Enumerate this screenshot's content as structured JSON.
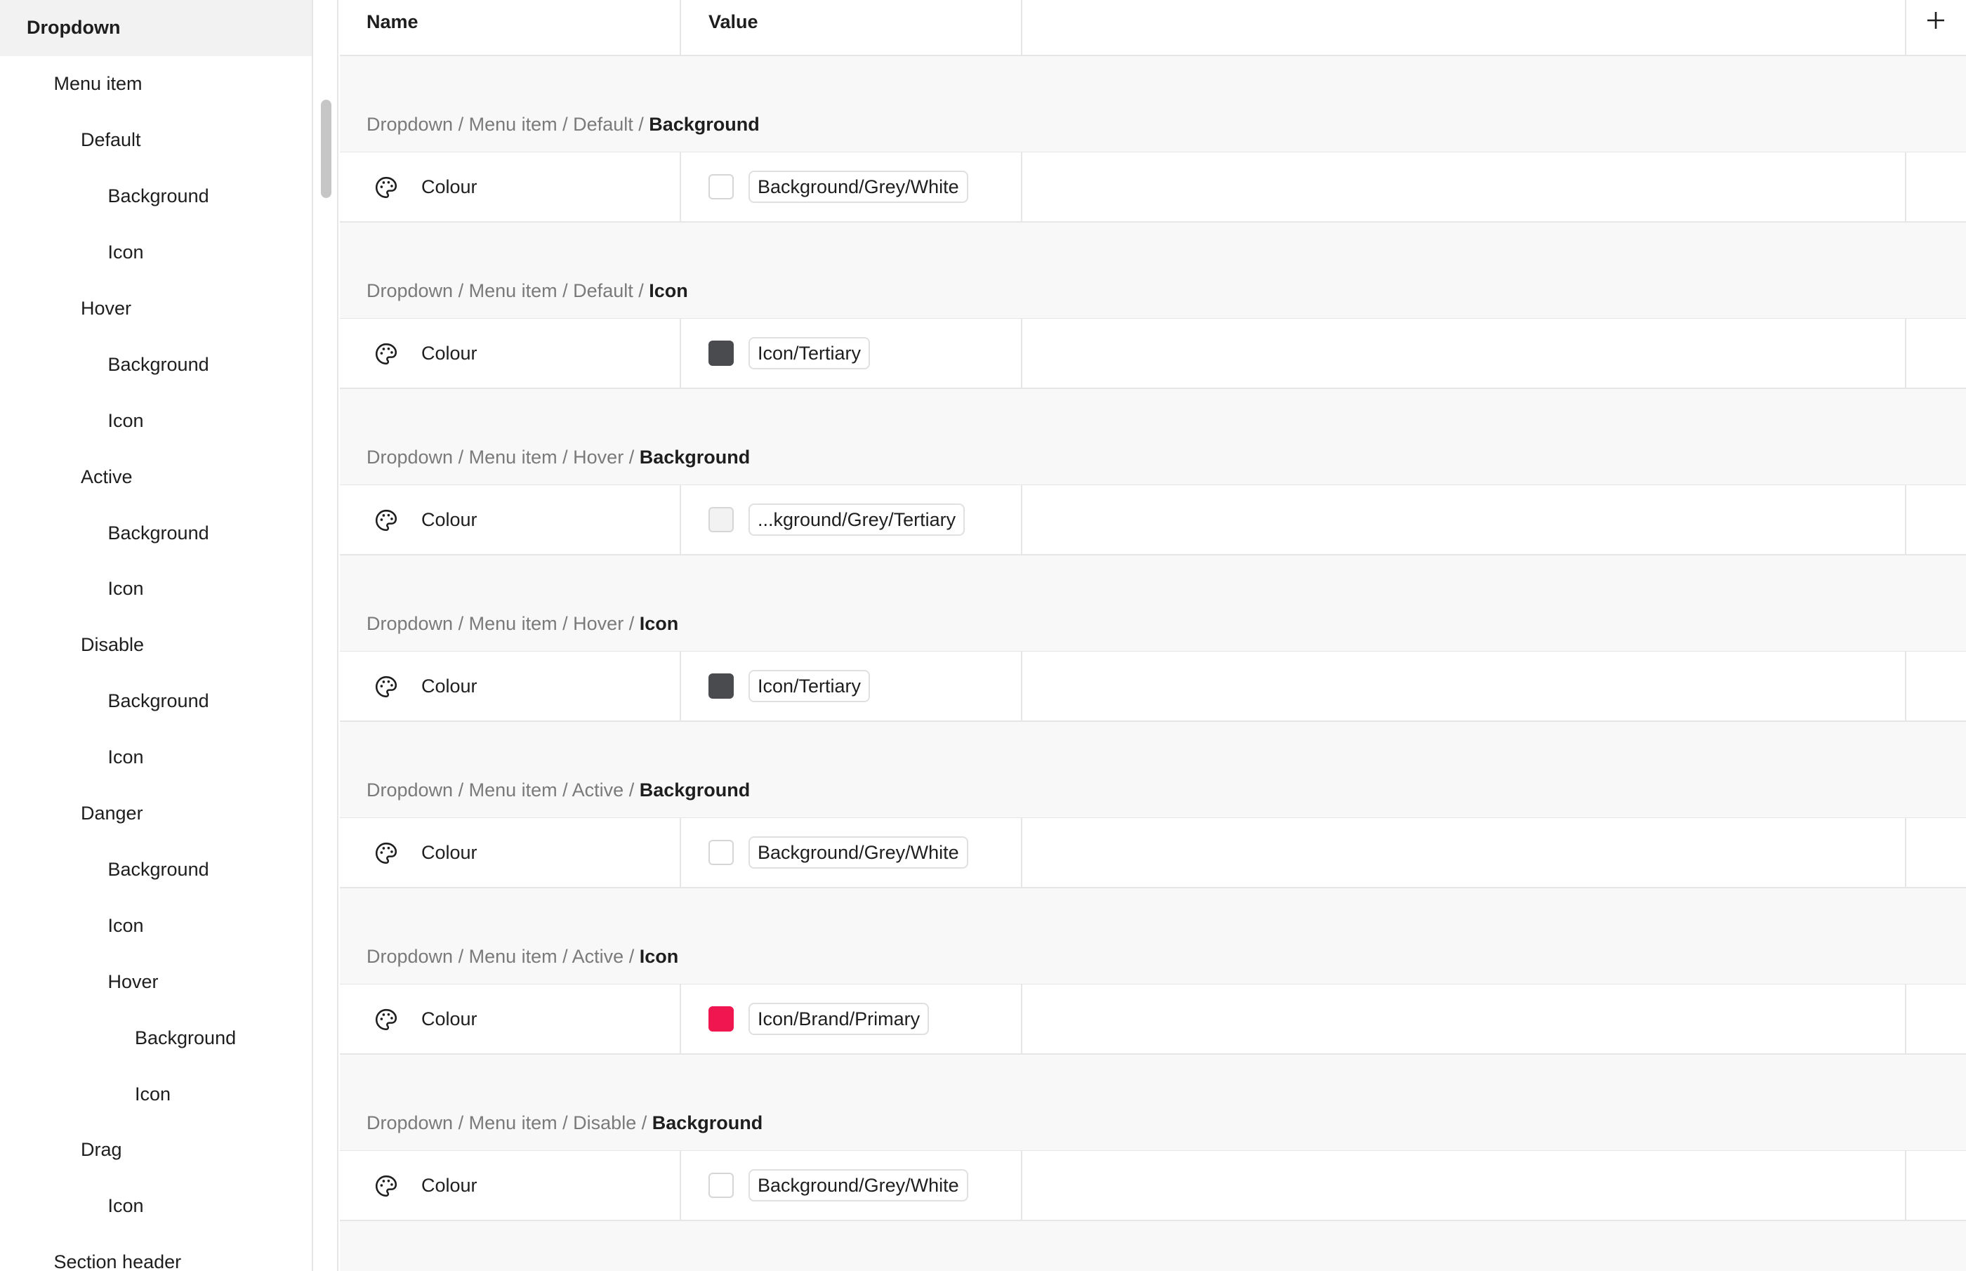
{
  "sidebar": {
    "items": [
      {
        "label": "Dropdown",
        "level": 0,
        "selected": true
      },
      {
        "label": "Menu item",
        "level": 1
      },
      {
        "label": "Default",
        "level": 2
      },
      {
        "label": "Background",
        "level": 3
      },
      {
        "label": "Icon",
        "level": 3
      },
      {
        "label": "Hover",
        "level": 2
      },
      {
        "label": "Background",
        "level": 3
      },
      {
        "label": "Icon",
        "level": 3
      },
      {
        "label": "Active",
        "level": 2
      },
      {
        "label": "Background",
        "level": 3
      },
      {
        "label": "Icon",
        "level": 3
      },
      {
        "label": "Disable",
        "level": 2
      },
      {
        "label": "Background",
        "level": 3
      },
      {
        "label": "Icon",
        "level": 3
      },
      {
        "label": "Danger",
        "level": 2
      },
      {
        "label": "Background",
        "level": 3
      },
      {
        "label": "Icon",
        "level": 3
      },
      {
        "label": "Hover",
        "level": 3
      },
      {
        "label": "Background",
        "level": 4
      },
      {
        "label": "Icon",
        "level": 4
      },
      {
        "label": "Drag",
        "level": 2
      },
      {
        "label": "Icon",
        "level": 3
      },
      {
        "label": "Section header",
        "level": 1
      }
    ]
  },
  "table": {
    "columns": {
      "name": "Name",
      "value": "Value"
    },
    "add_column_icon": "plus-icon",
    "groups": [
      {
        "path": [
          "Dropdown",
          "Menu item",
          "Default"
        ],
        "leaf": "Background",
        "row": {
          "icon": "palette-icon",
          "name": "Colour",
          "swatch": "#ffffff",
          "token": "Background/Grey/White"
        }
      },
      {
        "path": [
          "Dropdown",
          "Menu item",
          "Default"
        ],
        "leaf": "Icon",
        "row": {
          "icon": "palette-icon",
          "name": "Colour",
          "swatch": "#4a4b4f",
          "token": "Icon/Tertiary"
        }
      },
      {
        "path": [
          "Dropdown",
          "Menu item",
          "Hover"
        ],
        "leaf": "Background",
        "row": {
          "icon": "palette-icon",
          "name": "Colour",
          "swatch": "#f2f2f2",
          "token": "...kground/Grey/Tertiary"
        }
      },
      {
        "path": [
          "Dropdown",
          "Menu item",
          "Hover"
        ],
        "leaf": "Icon",
        "row": {
          "icon": "palette-icon",
          "name": "Colour",
          "swatch": "#4a4b4f",
          "token": "Icon/Tertiary"
        }
      },
      {
        "path": [
          "Dropdown",
          "Menu item",
          "Active"
        ],
        "leaf": "Background",
        "row": {
          "icon": "palette-icon",
          "name": "Colour",
          "swatch": "#ffffff",
          "token": "Background/Grey/White"
        }
      },
      {
        "path": [
          "Dropdown",
          "Menu item",
          "Active"
        ],
        "leaf": "Icon",
        "row": {
          "icon": "palette-icon",
          "name": "Colour",
          "swatch": "#f0164f",
          "token": "Icon/Brand/Primary"
        }
      },
      {
        "path": [
          "Dropdown",
          "Menu item",
          "Disable"
        ],
        "leaf": "Background",
        "row": {
          "icon": "palette-icon",
          "name": "Colour",
          "swatch": "#ffffff",
          "token": "Background/Grey/White"
        }
      }
    ]
  },
  "colors": {
    "selected_bg": "#f2f2f2",
    "divider": "#e6e6e6",
    "path_muted": "#7a7a7a",
    "text": "#1e1e1e"
  }
}
